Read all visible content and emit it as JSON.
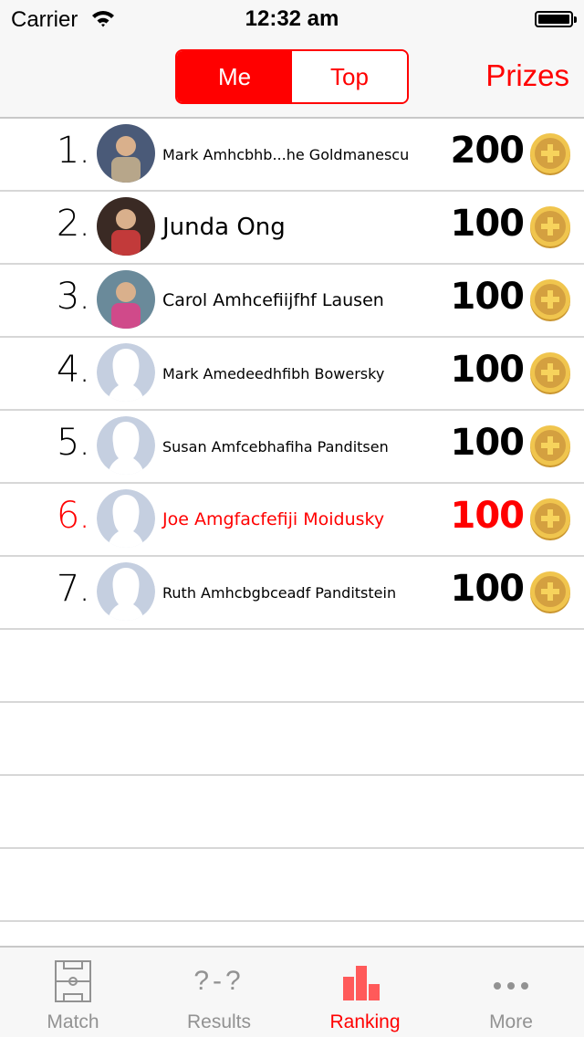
{
  "status_bar": {
    "carrier": "Carrier",
    "time": "12:32 am"
  },
  "header": {
    "segments": [
      {
        "label": "Me",
        "selected": true
      },
      {
        "label": "Top",
        "selected": false
      }
    ],
    "prizes_label": "Prizes"
  },
  "ranking": {
    "rows": [
      {
        "rank": "1.",
        "name": "Mark Amhcbhb...he Goldmanescu",
        "score": "200",
        "avatar": "photo",
        "highlight": false
      },
      {
        "rank": "2.",
        "name": "Junda Ong",
        "score": "100",
        "avatar": "photo",
        "highlight": false
      },
      {
        "rank": "3.",
        "name": "Carol Amhcefiijfhf Lausen",
        "score": "100",
        "avatar": "photo",
        "highlight": false
      },
      {
        "rank": "4.",
        "name": "Mark Amedeedhfibh Bowersky",
        "score": "100",
        "avatar": "placeholder",
        "highlight": false
      },
      {
        "rank": "5.",
        "name": "Susan Amfcebhafiha Panditsen",
        "score": "100",
        "avatar": "placeholder",
        "highlight": false
      },
      {
        "rank": "6.",
        "name": "Joe Amgfacfefiji Moidusky",
        "score": "100",
        "avatar": "placeholder",
        "highlight": true
      },
      {
        "rank": "7.",
        "name": "Ruth Amhcbgbceadf Panditstein",
        "score": "100",
        "avatar": "placeholder",
        "highlight": false
      }
    ]
  },
  "tabbar": {
    "tabs": [
      {
        "label": "Match",
        "icon": "soccer-field-icon",
        "active": false
      },
      {
        "label": "Results",
        "icon": "score-unknown-icon",
        "active": false
      },
      {
        "label": "Ranking",
        "icon": "bar-chart-icon",
        "active": true
      },
      {
        "label": "More",
        "icon": "more-dots-icon",
        "active": false
      }
    ],
    "results_icon_text": "?-?"
  },
  "colors": {
    "accent": "#ff0000",
    "tab_inactive": "#929292",
    "ranking_icon": "#ff5a5a",
    "coin": "#e8b94a",
    "placeholder_avatar": "#c5cfe0"
  }
}
